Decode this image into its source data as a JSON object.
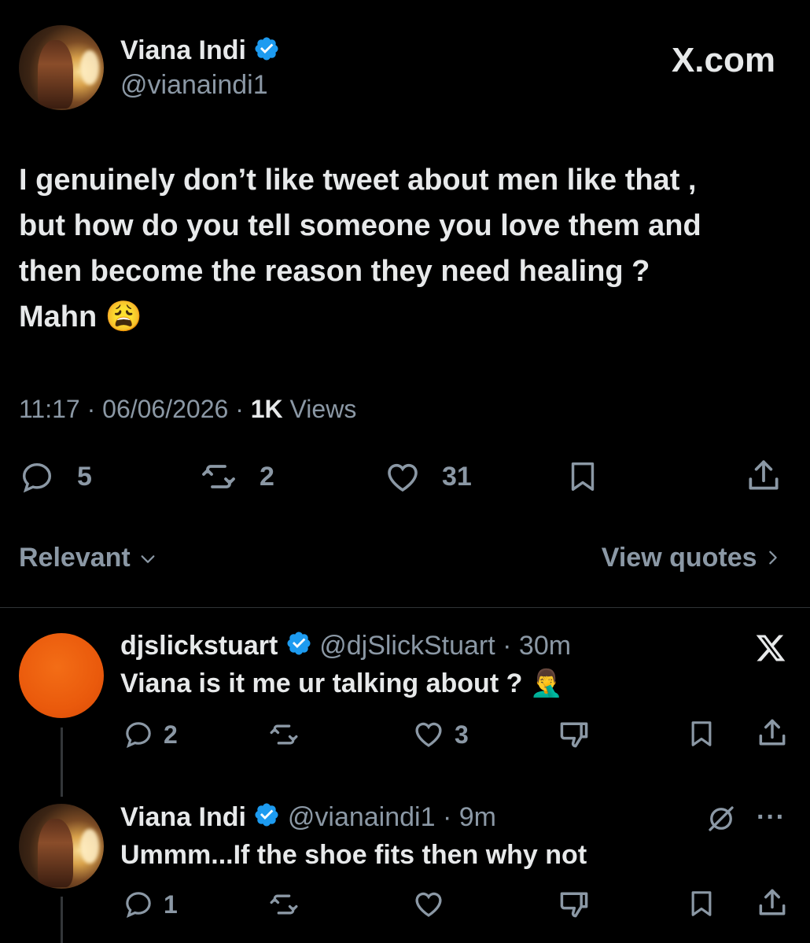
{
  "brand": {
    "site": "X.com"
  },
  "tweet": {
    "author_name": "Viana Indi",
    "author_handle": "@vianaindi1",
    "text_lines": [
      "I genuinely don’t like tweet about men like that ,",
      "but how do you tell someone you love them and",
      "then become the reason they need healing ?",
      "Mahn 😩"
    ],
    "time": "11:17",
    "date": "06/06/2026",
    "views_count": "1K",
    "views_label": "Views",
    "replies": "5",
    "reposts": "2",
    "likes": "31"
  },
  "sort": {
    "label": "Relevant",
    "quotes_label": "View quotes"
  },
  "replies": [
    {
      "name": "djslickstuart",
      "handle": "@djSlickStuart",
      "age": "30m",
      "text": "Viana is it me ur talking about ? 🤦‍♂️",
      "replies": "2",
      "likes": "3"
    },
    {
      "name": "Viana Indi",
      "handle": "@vianaindi1",
      "age": "9m",
      "text": "Ummm...If the shoe fits then why not",
      "replies": "1"
    }
  ],
  "colors": {
    "verified": "#1d9bf0",
    "muted": "#8b98a5",
    "bg": "#000000"
  }
}
